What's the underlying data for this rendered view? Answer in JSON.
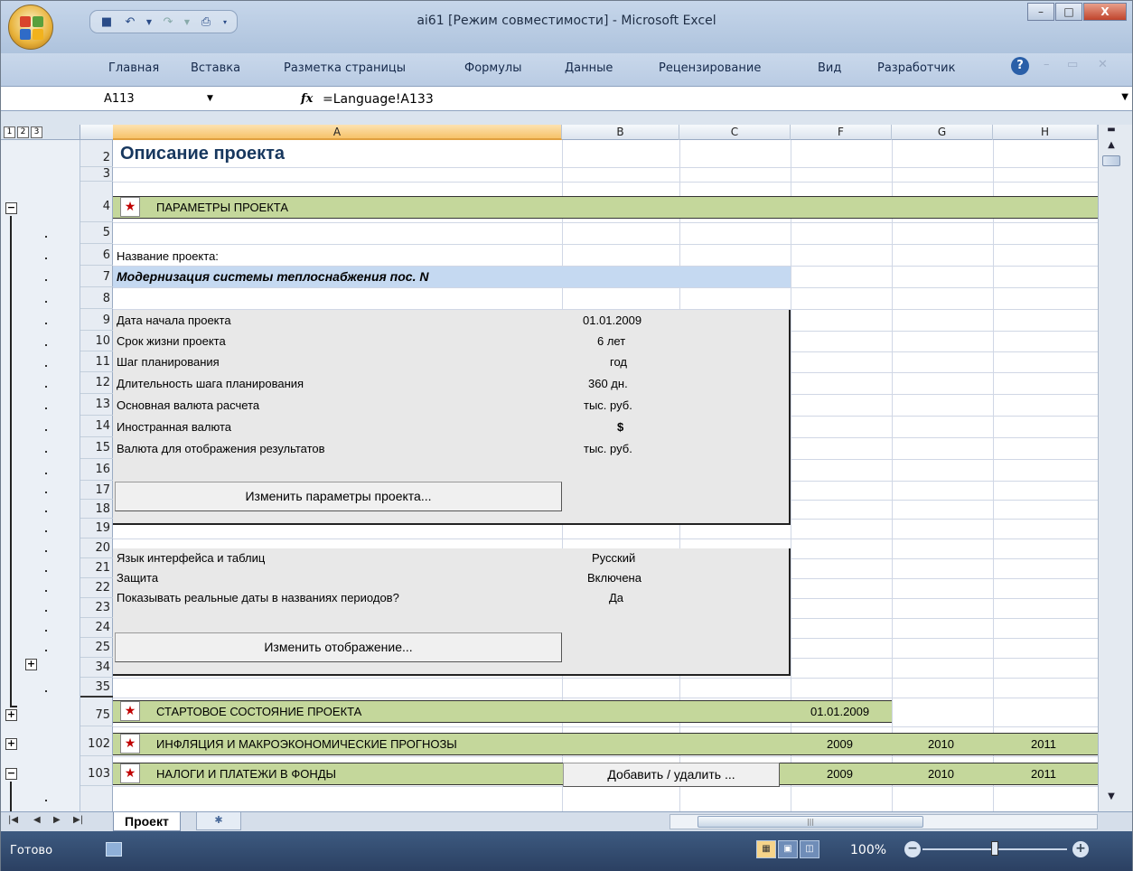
{
  "window": {
    "title": "ai61  [Режим совместимости] - Microsoft Excel",
    "minimize": "–",
    "maximize": "□",
    "close": "X"
  },
  "ribbon": {
    "tabs": [
      "Главная",
      "Вставка",
      "Разметка страницы",
      "Формулы",
      "Данные",
      "Рецензирование",
      "Вид",
      "Разработчик"
    ],
    "help": "?"
  },
  "formula_bar": {
    "name_box": "A113",
    "fx": "fx",
    "formula": "=Language!A133"
  },
  "outline_levels": [
    "1",
    "2",
    "3"
  ],
  "columns": [
    "A",
    "B",
    "C",
    "F",
    "G",
    "H"
  ],
  "rows": [
    "2",
    "3",
    "4",
    "5",
    "6",
    "7",
    "8",
    "9",
    "10",
    "11",
    "12",
    "13",
    "14",
    "15",
    "16",
    "17",
    "18",
    "19",
    "20",
    "21",
    "22",
    "23",
    "24",
    "25",
    "34",
    "35",
    "75",
    "102",
    "103"
  ],
  "sheet": {
    "title": "Описание проекта",
    "section_params": "ПАРАМЕТРЫ ПРОЕКТА",
    "project_name_label": "Название проекта:",
    "project_name": "Модернизация системы теплоснабжения пос. N",
    "params": [
      {
        "label": "Дата начала проекта",
        "value": "01.01.2009"
      },
      {
        "label": "Срок жизни проекта",
        "value": "6 лет"
      },
      {
        "label": "Шаг планирования",
        "value": "год"
      },
      {
        "label": "Длительность шага планирования",
        "value": "360 дн."
      },
      {
        "label": "Основная валюта расчета",
        "value": "тыс. руб."
      },
      {
        "label": "Иностранная валюта",
        "value": "$"
      },
      {
        "label": "Валюта для отображения результатов",
        "value": "тыс. руб."
      }
    ],
    "btn_change_params": "Изменить параметры проекта...",
    "display": [
      {
        "label": "Язык интерфейса и таблиц",
        "value": "Русский"
      },
      {
        "label": "Защита",
        "value": "Включена"
      },
      {
        "label": "Показывать реальные даты в названиях периодов?",
        "value": "Да"
      }
    ],
    "btn_change_display": "Изменить отображение...",
    "section_start": "СТАРТОВОЕ СОСТОЯНИЕ ПРОЕКТА",
    "section_start_date": "01.01.2009",
    "section_inflation": "ИНФЛЯЦИЯ И МАКРОЭКОНОМИЧЕСКИЕ ПРОГНОЗЫ",
    "section_taxes": "НАЛОГИ И ПЛАТЕЖИ В ФОНДЫ",
    "btn_add_remove": "Добавить / удалить ...",
    "years": [
      "2009",
      "2010",
      "2011"
    ],
    "star": "★"
  },
  "sheet_tabs": {
    "active": "Проект"
  },
  "status": {
    "ready": "Готово",
    "zoom": "100%"
  }
}
